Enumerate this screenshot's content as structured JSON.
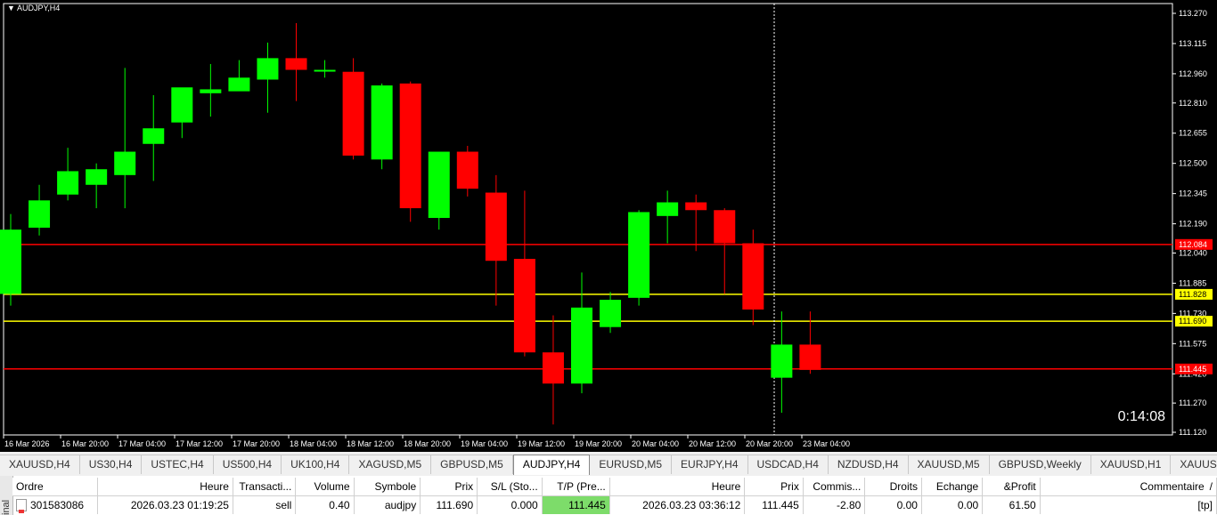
{
  "chart": {
    "title": "AUDJPY,H4",
    "countdown": "0:14:08",
    "price_labels": [
      "113.270",
      "113.115",
      "112.960",
      "112.810",
      "112.655",
      "112.500",
      "112.345",
      "112.190",
      "112.040",
      "111.885",
      "111.730",
      "111.575",
      "111.420",
      "111.270",
      "111.120"
    ],
    "time_labels": [
      "16 Mar 2026",
      "16 Mar 20:00",
      "17 Mar 04:00",
      "17 Mar 12:00",
      "17 Mar 20:00",
      "18 Mar 04:00",
      "18 Mar 12:00",
      "18 Mar 20:00",
      "19 Mar 04:00",
      "19 Mar 12:00",
      "19 Mar 20:00",
      "20 Mar 04:00",
      "20 Mar 12:00",
      "20 Mar 20:00",
      "23 Mar 04:00"
    ],
    "levels": [
      {
        "price": 112.084,
        "label": "112.084",
        "color": "#ff0000"
      },
      {
        "price": 111.828,
        "label": "111.828",
        "color": "#ffff00"
      },
      {
        "price": 111.69,
        "label": "111.690",
        "color": "#ffff00"
      },
      {
        "price": 111.445,
        "label": "111.445",
        "color": "#ff0000"
      }
    ],
    "bull_color": "#00ff00",
    "bear_color": "#ff0000"
  },
  "chart_data": {
    "type": "candlestick",
    "title": "AUDJPY,H4",
    "ylim": [
      111.12,
      113.27
    ],
    "candles": [
      {
        "o": 111.83,
        "h": 112.24,
        "l": 111.77,
        "c": 112.16
      },
      {
        "o": 112.17,
        "h": 112.39,
        "l": 112.13,
        "c": 112.31
      },
      {
        "o": 112.34,
        "h": 112.58,
        "l": 112.31,
        "c": 112.46
      },
      {
        "o": 112.39,
        "h": 112.5,
        "l": 112.27,
        "c": 112.47
      },
      {
        "o": 112.44,
        "h": 112.99,
        "l": 112.27,
        "c": 112.56
      },
      {
        "o": 112.6,
        "h": 112.85,
        "l": 112.41,
        "c": 112.68
      },
      {
        "o": 112.71,
        "h": 112.85,
        "l": 112.63,
        "c": 112.89
      },
      {
        "o": 112.86,
        "h": 113.01,
        "l": 112.74,
        "c": 112.88
      },
      {
        "o": 112.87,
        "h": 113.03,
        "l": 112.89,
        "c": 112.94
      },
      {
        "o": 112.93,
        "h": 113.12,
        "l": 112.76,
        "c": 113.04
      },
      {
        "o": 113.04,
        "h": 113.22,
        "l": 112.82,
        "c": 112.98
      },
      {
        "o": 112.98,
        "h": 113.03,
        "l": 112.94,
        "c": 112.98
      },
      {
        "o": 112.97,
        "h": 113.04,
        "l": 112.52,
        "c": 112.54
      },
      {
        "o": 112.52,
        "h": 112.91,
        "l": 112.47,
        "c": 112.9
      },
      {
        "o": 112.91,
        "h": 112.92,
        "l": 112.2,
        "c": 112.27
      },
      {
        "o": 112.22,
        "h": 112.55,
        "l": 112.16,
        "c": 112.56
      },
      {
        "o": 112.56,
        "h": 112.59,
        "l": 112.33,
        "c": 112.37
      },
      {
        "o": 112.35,
        "h": 112.44,
        "l": 111.77,
        "c": 112.0
      },
      {
        "o": 112.01,
        "h": 112.36,
        "l": 111.51,
        "c": 111.53
      },
      {
        "o": 111.53,
        "h": 111.72,
        "l": 111.16,
        "c": 111.37
      },
      {
        "o": 111.37,
        "h": 111.94,
        "l": 111.32,
        "c": 111.76
      },
      {
        "o": 111.66,
        "h": 111.84,
        "l": 111.63,
        "c": 111.8
      },
      {
        "o": 111.81,
        "h": 112.26,
        "l": 111.77,
        "c": 112.25
      },
      {
        "o": 112.23,
        "h": 112.36,
        "l": 112.09,
        "c": 112.3
      },
      {
        "o": 112.3,
        "h": 112.34,
        "l": 112.05,
        "c": 112.26
      },
      {
        "o": 112.26,
        "h": 112.27,
        "l": 111.83,
        "c": 112.09
      },
      {
        "o": 112.09,
        "h": 112.16,
        "l": 111.67,
        "c": 111.75
      },
      {
        "o": 111.4,
        "h": 111.74,
        "l": 111.22,
        "c": 111.57
      },
      {
        "o": 111.57,
        "h": 111.74,
        "l": 111.42,
        "c": 111.44
      }
    ]
  },
  "tabs": [
    {
      "label": "XAUUSD,H4",
      "active": false
    },
    {
      "label": "US30,H4",
      "active": false
    },
    {
      "label": "USTEC,H4",
      "active": false
    },
    {
      "label": "US500,H4",
      "active": false
    },
    {
      "label": "UK100,H4",
      "active": false
    },
    {
      "label": "XAGUSD,M5",
      "active": false
    },
    {
      "label": "GBPUSD,M5",
      "active": false
    },
    {
      "label": "AUDJPY,H4",
      "active": true
    },
    {
      "label": "EURUSD,M5",
      "active": false
    },
    {
      "label": "EURJPY,H4",
      "active": false
    },
    {
      "label": "USDCAD,H4",
      "active": false
    },
    {
      "label": "NZDUSD,H4",
      "active": false
    },
    {
      "label": "XAUUSD,M5",
      "active": false
    },
    {
      "label": "GBPUSD,Weekly",
      "active": false
    },
    {
      "label": "XAUUSD,H1",
      "active": false
    },
    {
      "label": "XAUUSD,W",
      "active": false
    }
  ],
  "terminal": {
    "side_label": "inal",
    "columns": [
      "Ordre",
      "Heure",
      "Transacti...",
      "Volume",
      "Symbole",
      "Prix",
      "S/L (Sto...",
      "T/P (Pre...",
      "Heure",
      "Prix",
      "Commis...",
      "Droits",
      "Echange",
      "&Profit",
      "Commentaire"
    ],
    "sort_indicator": "/",
    "rows": [
      [
        "301583086",
        "2026.03.23 01:19:25",
        "sell",
        "0.40",
        "audjpy",
        "111.690",
        "0.000",
        "111.445",
        "2026.03.23 03:36:12",
        "111.445",
        "-2.80",
        "0.00",
        "0.00",
        "61.50",
        "[tp]"
      ]
    ]
  }
}
